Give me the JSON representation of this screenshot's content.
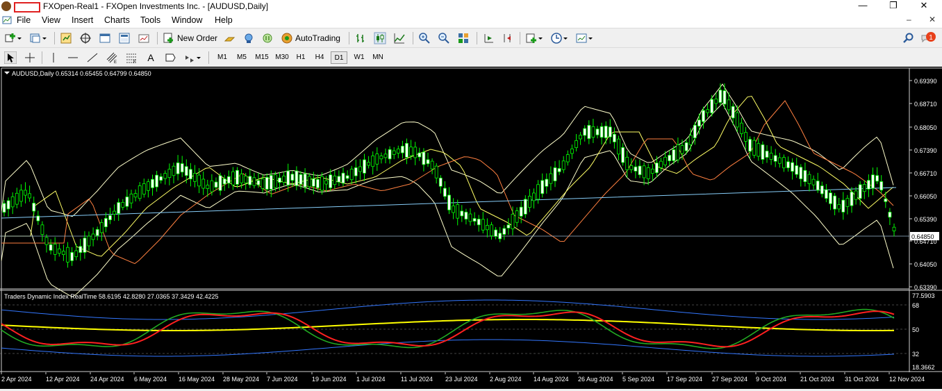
{
  "window": {
    "title": "FXOpen-Real1 - FXOpen Investments Inc. - [AUDUSD,Daily]",
    "controls": [
      "—",
      "❐",
      "✕"
    ]
  },
  "menu": [
    "File",
    "View",
    "Insert",
    "Charts",
    "Tools",
    "Window",
    "Help"
  ],
  "mdi": {
    "minimize": "–",
    "close": "✕"
  },
  "notifications": {
    "count": "1"
  },
  "toolbar": {
    "new_order": "New Order",
    "auto_trading": "AutoTrading"
  },
  "drawing": {
    "text_tool": "A"
  },
  "timeframes": [
    "M1",
    "M5",
    "M15",
    "M30",
    "H1",
    "H4",
    "D1",
    "W1",
    "MN"
  ],
  "timeframe_active": "D1",
  "chart": {
    "header": "AUDUSD,Daily  0.65314 0.65455 0.64799 0.64850",
    "price_labels": [
      "0.69390",
      "0.68710",
      "0.68050",
      "0.67390",
      "0.66710",
      "0.66050",
      "0.65390",
      "0.64710",
      "0.64050",
      "0.63390"
    ],
    "current_price": "0.64850",
    "indicator_header": "Traders Dynamic Index RealTime 58.6195 42.8280 27.0365 37.3429 42.4225",
    "indicator_labels": [
      "77.5903",
      "68",
      "50",
      "32",
      "18.3662"
    ],
    "date_labels": [
      "2 Apr 2024",
      "12 Apr 2024",
      "24 Apr 2024",
      "6 May 2024",
      "16 May 2024",
      "28 May 2024",
      "7 Jun 2024",
      "19 Jun 2024",
      "1 Jul 2024",
      "11 Jul 2024",
      "23 Jul 2024",
      "2 Aug 2024",
      "14 Aug 2024",
      "26 Aug 2024",
      "5 Sep 2024",
      "17 Sep 2024",
      "27 Sep 2024",
      "9 Oct 2024",
      "21 Oct 2024",
      "31 Oct 2024",
      "12 Nov 2024"
    ],
    "colors": {
      "background": "#000000",
      "candle": "#00ff00",
      "bull_body": "#ffffff",
      "upper_band": "#ffffcc",
      "ma_fast": "#ffff66",
      "ma_slow": "#ff8040",
      "ma_long": "#87cefa",
      "tdi_price": "#22aa22",
      "tdi_signal": "#ff2020",
      "tdi_mid": "#ffff00",
      "tdi_bands": "#3377ff"
    }
  }
}
